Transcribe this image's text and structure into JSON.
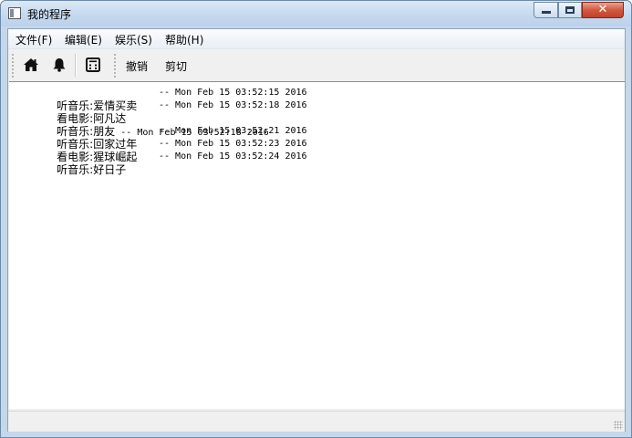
{
  "window": {
    "title": "我的程序",
    "close_glyph": "✕"
  },
  "menu": [
    {
      "label": "文件(F)"
    },
    {
      "label": "编辑(E)"
    },
    {
      "label": "娱乐(S)"
    },
    {
      "label": "帮助(H)"
    }
  ],
  "toolbar": {
    "icons": [
      "home-icon",
      "bell-icon",
      "calculator-icon"
    ],
    "undo_label": "撤销",
    "cut_label": "剪切"
  },
  "log": [
    {
      "category": "听音乐:",
      "item": "爱情买卖",
      "timestamp": "-- Mon Feb 15 03:52:15 2016"
    },
    {
      "category": "看电影:",
      "item": "阿凡达",
      "timestamp": "-- Mon Feb 15 03:52:18 2016"
    },
    {
      "category": "听音乐:",
      "item": "朋友",
      "timestamp": "-- Mon Feb 15 03:52:18 2016",
      "inline": true
    },
    {
      "category": "听音乐:",
      "item": "回家过年",
      "timestamp": "-- Mon Feb 15 03:52:21 2016"
    },
    {
      "category": "看电影:",
      "item": "猩球崛起",
      "timestamp": "-- Mon Feb 15 03:52:23 2016"
    },
    {
      "category": "听音乐:",
      "item": "好日子",
      "timestamp": "-- Mon Feb 15 03:52:24 2016"
    }
  ],
  "colors": {
    "title_bar": "#c4d8ee",
    "close_button": "#cf5a3f",
    "editor_border": "#6a93c8"
  }
}
